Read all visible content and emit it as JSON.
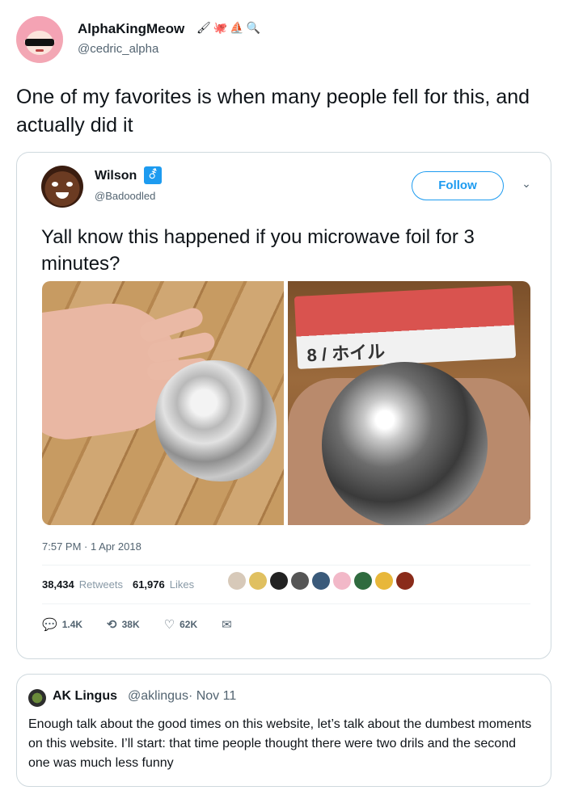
{
  "outer_tweet": {
    "display_name": "AlphaKingMeow",
    "badges": [
      "🖌",
      "🐙",
      "⛵",
      "🔍"
    ],
    "handle": "@cedric_alpha",
    "text": "One of my favorites is when many people fell for this, and actually did it"
  },
  "embedded_tweet": {
    "display_name": "Wilson",
    "badge_glyph": "⚦",
    "handle": "@Badoodled",
    "follow_label": "Follow",
    "chevron": "⌄",
    "text": "Yall know this happened if you microwave foil for 3 minutes?",
    "photo_box_label": "8 / ホイル",
    "timestamp": "7:57 PM · 1 Apr 2018",
    "retweets_count": "38,434",
    "retweets_label": "Retweets",
    "likes_count": "61,976",
    "likes_label": "Likes",
    "liker_colors": [
      "#d7c9b9",
      "#e0c060",
      "#222222",
      "#555555",
      "#3a5a7a",
      "#f2b8c8",
      "#2f6b3f",
      "#e8b73a",
      "#8a2b1a"
    ],
    "actions": {
      "reply_icon": "💬",
      "reply_count": "1.4K",
      "retweet_icon": "⟲",
      "retweet_count": "38K",
      "like_icon": "♡",
      "like_count": "62K",
      "dm_icon": "✉"
    }
  },
  "quote_tweet": {
    "display_name": "AK Lingus",
    "handle_and_date": "@aklingus· Nov 11",
    "text": "Enough talk about the good times on this website, let’s talk about the dumbest moments on this website. I’ll start: that time people thought there were two drils and the second one was much less funny"
  }
}
